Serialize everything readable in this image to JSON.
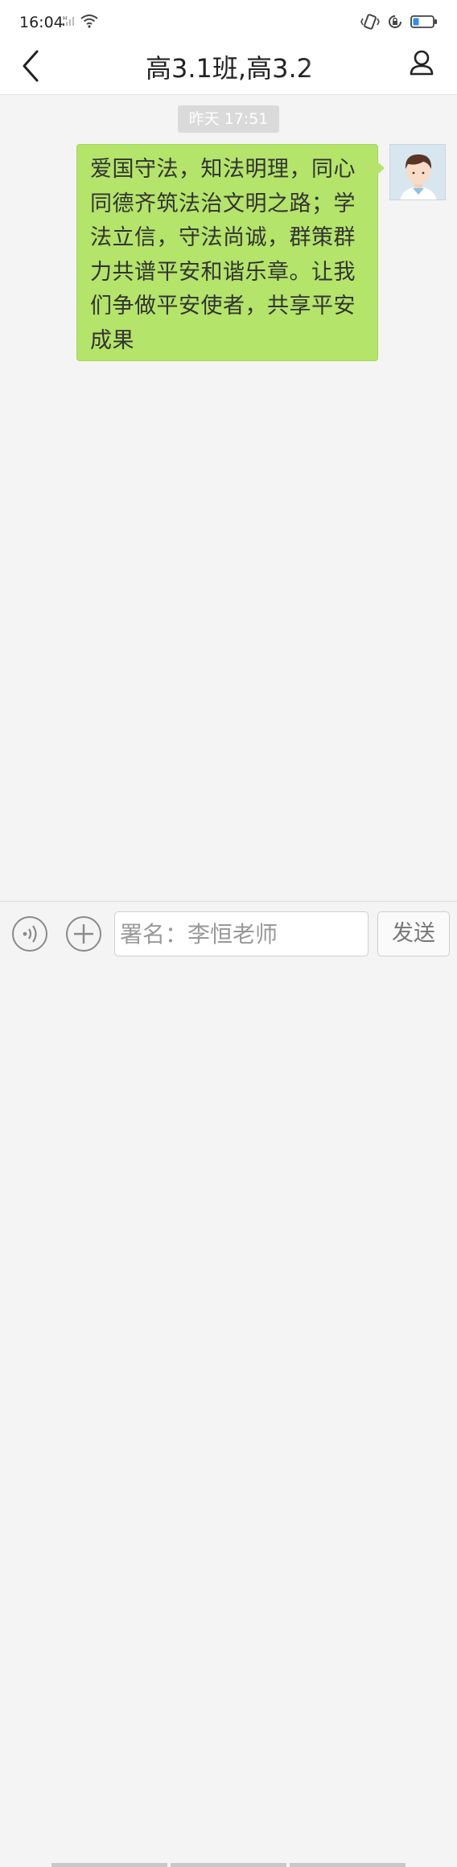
{
  "status_bar": {
    "time": "16:04",
    "net_label": "H",
    "icons": [
      "signal-icon",
      "wifi-icon",
      "vibrate-icon",
      "rotation-lock-icon",
      "battery-icon"
    ]
  },
  "navbar": {
    "back_icon": "chevron-left-icon",
    "title": "高3.1班,高3.2",
    "profile_icon": "person-icon"
  },
  "chat": {
    "timestamp": "昨天 17:51",
    "messages": [
      {
        "sender": "me",
        "avatar_icon": "user-avatar",
        "text": "爱国守法，知法明理，同心同德齐筑法治文明之路；学法立信，守法尚诚，群策群力共谱平安和谐乐章。让我们争做平安使者，共享平安成果"
      }
    ]
  },
  "input_bar": {
    "voice_icon": "voice-icon",
    "plus_icon": "plus-icon",
    "input_value": "署名：李恒老师",
    "send_label": "发送"
  },
  "colors": {
    "bubble": "#b4e46a",
    "background": "#f4f4f4",
    "timestamp_chip": "#dadada"
  }
}
